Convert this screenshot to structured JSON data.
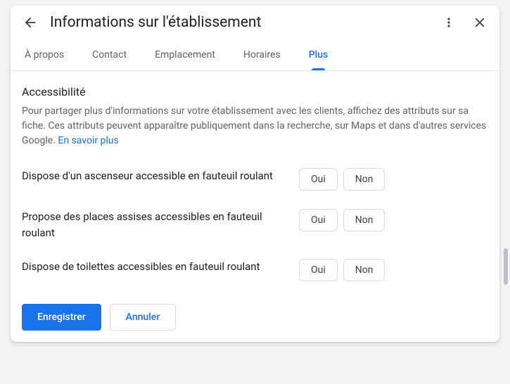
{
  "header": {
    "title": "Informations sur l'établissement"
  },
  "tabs": [
    {
      "label": "À propos",
      "active": false
    },
    {
      "label": "Contact",
      "active": false
    },
    {
      "label": "Emplacement",
      "active": false
    },
    {
      "label": "Horaires",
      "active": false
    },
    {
      "label": "Plus",
      "active": true
    }
  ],
  "section": {
    "title": "Accessibilité",
    "description": "Pour partager plus d'informations sur votre établissement avec les clients, affichez des attributs sur sa fiche. Ces attributs peuvent apparaître publiquement dans la recherche, sur Maps et dans d'autres services Google. ",
    "learn_more": "En savoir plus"
  },
  "attributes": [
    {
      "label": "Dispose d'un ascenseur accessible en fauteuil roulant",
      "yes": "Oui",
      "no": "Non"
    },
    {
      "label": "Propose des places assises accessibles en fauteuil roulant",
      "yes": "Oui",
      "no": "Non"
    },
    {
      "label": "Dispose de toilettes accessibles en fauteuil roulant",
      "yes": "Oui",
      "no": "Non"
    }
  ],
  "footer": {
    "save": "Enregistrer",
    "cancel": "Annuler"
  }
}
